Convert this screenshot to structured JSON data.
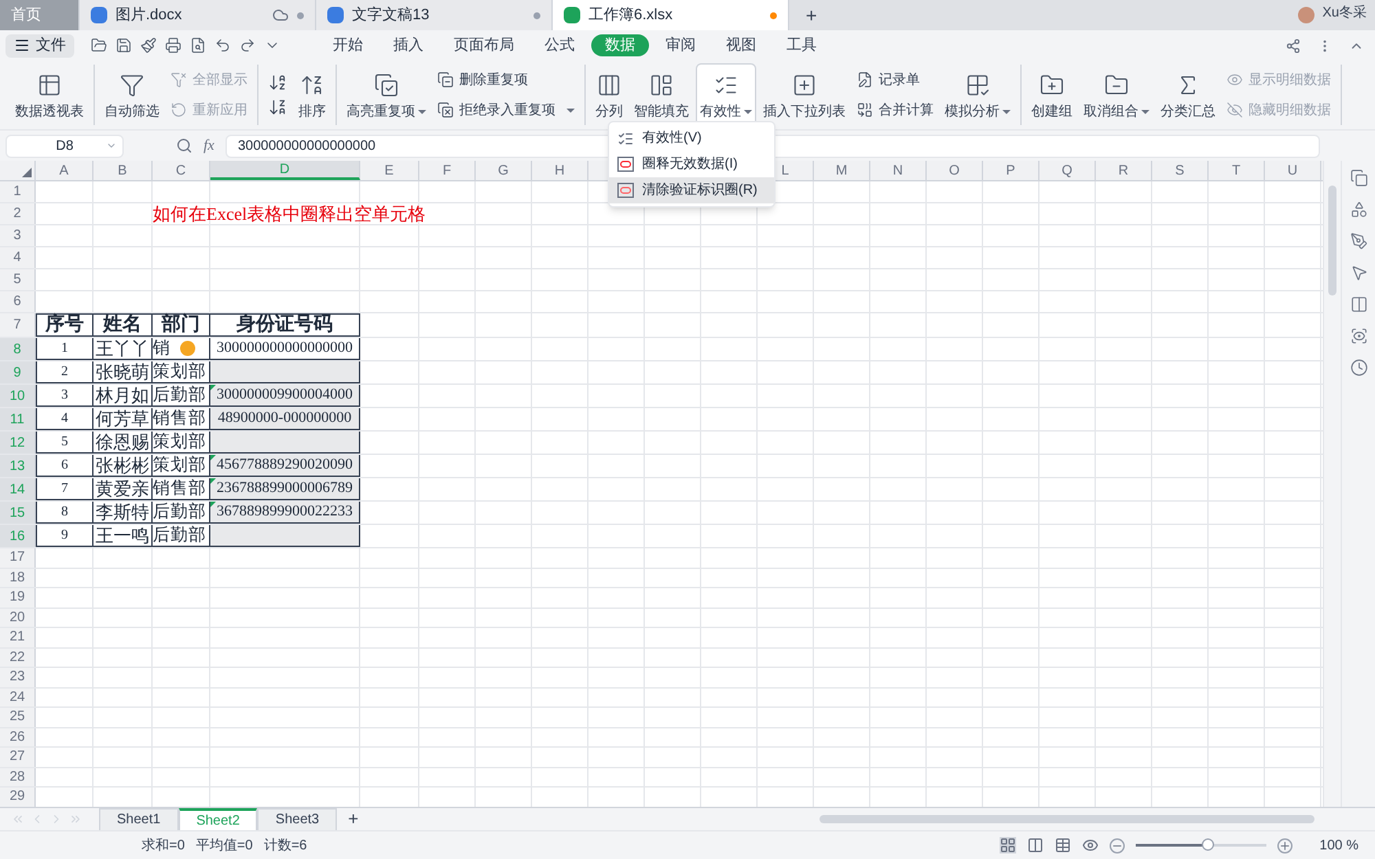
{
  "doc_tabs": [
    {
      "label": "首页",
      "kind": "home",
      "selected": false
    },
    {
      "label": "图片.docx",
      "kind": "doc",
      "selected": false
    },
    {
      "label": "文字文稿13",
      "kind": "doc",
      "selected": false
    },
    {
      "label": "工作簿6.xlsx",
      "kind": "sheet",
      "selected": true
    }
  ],
  "new_tab": "+",
  "user": "Xu冬采",
  "file_menu": "文件",
  "ribbon_tabs": [
    {
      "label": "开始",
      "selected": false
    },
    {
      "label": "插入",
      "selected": false
    },
    {
      "label": "页面布局",
      "selected": false
    },
    {
      "label": "公式",
      "selected": false
    },
    {
      "label": "数据",
      "selected": true
    },
    {
      "label": "审阅",
      "selected": false
    },
    {
      "label": "视图",
      "selected": false
    },
    {
      "label": "工具",
      "selected": false
    }
  ],
  "ribbon": [
    {
      "items": [
        {
          "kind": "large",
          "label": "数据透视表",
          "dropdown": false,
          "pressed": false,
          "disabled": false
        }
      ]
    },
    {
      "items": [
        {
          "kind": "large",
          "label": "自动筛选",
          "dropdown": false,
          "pressed": false,
          "disabled": false
        },
        {
          "kind": "small",
          "label": "全部显示",
          "dropdown": false,
          "pressed": false,
          "disabled": true
        },
        {
          "kind": "small",
          "label": "重新应用",
          "dropdown": false,
          "pressed": false,
          "disabled": true
        }
      ]
    },
    {
      "items": [
        {
          "kind": "icon",
          "dropdown": false,
          "pressed": false,
          "disabled": false
        },
        {
          "kind": "icon",
          "dropdown": false,
          "pressed": false,
          "disabled": false
        },
        {
          "kind": "large",
          "label": "排序",
          "dropdown": false,
          "pressed": false,
          "disabled": false
        }
      ]
    },
    {
      "items": [
        {
          "kind": "large",
          "label": "高亮重复项",
          "dropdown": true,
          "pressed": false,
          "disabled": false
        },
        {
          "kind": "small",
          "label": "删除重复项",
          "dropdown": false,
          "pressed": false,
          "disabled": false
        },
        {
          "kind": "small",
          "label": "拒绝录入重复项",
          "dropdown": true,
          "pressed": false,
          "disabled": false
        }
      ]
    },
    {
      "items": [
        {
          "kind": "large",
          "label": "分列",
          "dropdown": false,
          "pressed": false,
          "disabled": false
        },
        {
          "kind": "large",
          "label": "智能填充",
          "dropdown": false,
          "pressed": false,
          "disabled": false
        },
        {
          "kind": "large",
          "label": "有效性",
          "dropdown": true,
          "pressed": true,
          "disabled": false
        },
        {
          "kind": "large",
          "label": "插入下拉列表",
          "dropdown": false,
          "pressed": false,
          "disabled": false
        },
        {
          "kind": "small",
          "label": "记录单",
          "dropdown": false,
          "pressed": false,
          "disabled": false
        },
        {
          "kind": "small",
          "label": "合并计算",
          "dropdown": false,
          "pressed": false,
          "disabled": false
        },
        {
          "kind": "large",
          "label": "模拟分析",
          "dropdown": true,
          "pressed": false,
          "disabled": false
        }
      ]
    },
    {
      "items": [
        {
          "kind": "large",
          "label": "创建组",
          "dropdown": false,
          "pressed": false,
          "disabled": false
        },
        {
          "kind": "large",
          "label": "取消组合",
          "dropdown": true,
          "pressed": false,
          "disabled": false
        },
        {
          "kind": "large",
          "label": "分类汇总",
          "dropdown": false,
          "pressed": false,
          "disabled": false
        },
        {
          "kind": "small",
          "label": "显示明细数据",
          "dropdown": false,
          "pressed": false,
          "disabled": true
        },
        {
          "kind": "small",
          "label": "隐藏明细数据",
          "dropdown": false,
          "pressed": false,
          "disabled": true
        }
      ]
    }
  ],
  "name_box": "D8",
  "formula_label": "fx",
  "formula": "300000000000000000",
  "columns": [
    {
      "label": "A",
      "selected": false
    },
    {
      "label": "B",
      "selected": false
    },
    {
      "label": "C",
      "selected": false
    },
    {
      "label": "D",
      "selected": true
    },
    {
      "label": "E",
      "selected": false
    },
    {
      "label": "F",
      "selected": false
    },
    {
      "label": "G",
      "selected": false
    },
    {
      "label": "H",
      "selected": false
    },
    {
      "label": "L",
      "selected": false
    },
    {
      "label": "M",
      "selected": false
    },
    {
      "label": "N",
      "selected": false
    },
    {
      "label": "O",
      "selected": false
    },
    {
      "label": "P",
      "selected": false
    },
    {
      "label": "Q",
      "selected": false
    },
    {
      "label": "R",
      "selected": false
    },
    {
      "label": "S",
      "selected": false
    },
    {
      "label": "T",
      "selected": false
    },
    {
      "label": "U",
      "selected": false
    }
  ],
  "row_numbers": [
    "1",
    "2",
    "3",
    "4",
    "5",
    "6",
    "7",
    "8",
    "9",
    "10",
    "11",
    "12",
    "13",
    "14",
    "15",
    "16",
    "17",
    "18",
    "19",
    "20",
    "21",
    "22",
    "23",
    "24",
    "25",
    "26",
    "27",
    "28",
    "29"
  ],
  "title": "如何在Excel表格中圈释出空单元格",
  "table": {
    "header": [
      "序号",
      "姓名",
      "部门",
      "身份证号码"
    ],
    "rows": [
      {
        "seq": "1",
        "name": "王丫丫",
        "dept": "销",
        "id": "300000000000000000",
        "selected": true,
        "active": true,
        "warning": true,
        "flag": false
      },
      {
        "seq": "2",
        "name": "张晓萌",
        "dept": "策划部",
        "selected": true,
        "active": false,
        "warning": false,
        "flag": false
      },
      {
        "seq": "3",
        "name": "林月如",
        "dept": "后勤部",
        "id": "300000009900004000",
        "selected": true,
        "active": false,
        "warning": false,
        "flag": true
      },
      {
        "seq": "4",
        "name": "何芳草",
        "dept": "销售部",
        "id": "48900000-000000000",
        "selected": true,
        "active": false,
        "warning": false,
        "flag": false
      },
      {
        "seq": "5",
        "name": "徐恩赐",
        "dept": "策划部",
        "selected": true,
        "active": false,
        "warning": false,
        "flag": false
      },
      {
        "seq": "6",
        "name": "张彬彬",
        "dept": "策划部",
        "id": "456778889290020090",
        "selected": true,
        "active": false,
        "warning": false,
        "flag": true
      },
      {
        "seq": "7",
        "name": "黄爱亲",
        "dept": "销售部",
        "id": "236788899000006789",
        "selected": true,
        "active": false,
        "warning": false,
        "flag": true
      },
      {
        "seq": "8",
        "name": "李斯特",
        "dept": "后勤部",
        "id": "367889899900022233",
        "selected": true,
        "active": false,
        "warning": false,
        "flag": true
      },
      {
        "seq": "9",
        "name": "王一鸣",
        "dept": "后勤部",
        "selected": true,
        "active": false,
        "warning": false,
        "flag": false
      }
    ]
  },
  "menu": [
    {
      "label": "有效性(V)",
      "selected": false
    },
    {
      "label": "圈释无效数据(I)",
      "selected": false
    },
    {
      "label": "清除验证标识圈(R)",
      "selected": true
    }
  ],
  "sheets": [
    {
      "label": "Sheet1",
      "selected": false
    },
    {
      "label": "Sheet2",
      "selected": true
    },
    {
      "label": "Sheet3",
      "selected": false
    }
  ],
  "new_sheet": "+",
  "status": [
    "求和=0",
    "平均值=0",
    "计数=6"
  ],
  "zoom": {
    "level": 0.55,
    "reading": "100 %"
  }
}
